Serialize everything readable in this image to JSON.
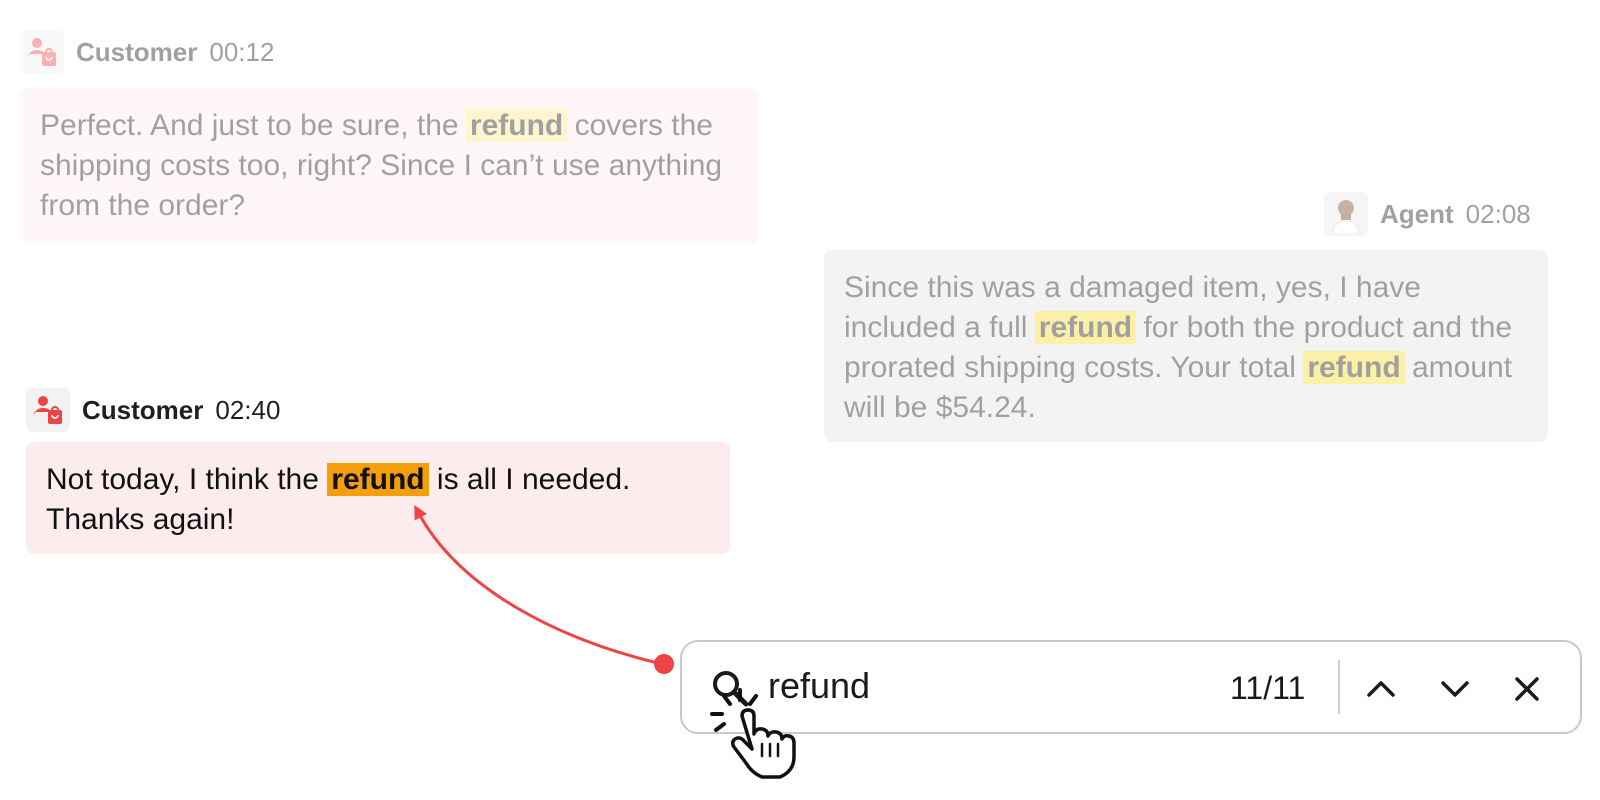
{
  "messages": [
    {
      "role": "customer",
      "sender": "Customer",
      "time": "00:12",
      "text_parts": [
        "Perfect. And just to be sure, the ",
        "refund",
        " covers the shipping costs too, right? Since I can’t use anything from the order?"
      ]
    },
    {
      "role": "agent",
      "sender": "Agent",
      "time": "02:08",
      "text_parts": [
        "Since this was a damaged item, yes, I have included a full ",
        "refund",
        " for both the product and the prorated shipping costs. Your total ",
        "refund",
        " amount will be $54.24."
      ]
    },
    {
      "role": "customer",
      "sender": "Customer",
      "time": "02:40",
      "text_parts": [
        "Not today, I think the ",
        "refund",
        " is all I needed. Thanks again!"
      ]
    }
  ],
  "search": {
    "query": "refund",
    "counter": "11/11",
    "prev_icon": "chevron-up-icon",
    "next_icon": "chevron-down-icon",
    "close_icon": "close-icon",
    "search_icon": "search-icon"
  },
  "colors": {
    "customer_accent": "#ef4444",
    "customer_bubble": "#fdecee",
    "agent_bubble": "#f3f3f3",
    "highlight": "#fde68a",
    "active_highlight": "#f59e0b",
    "arrow": "#ef4444"
  }
}
